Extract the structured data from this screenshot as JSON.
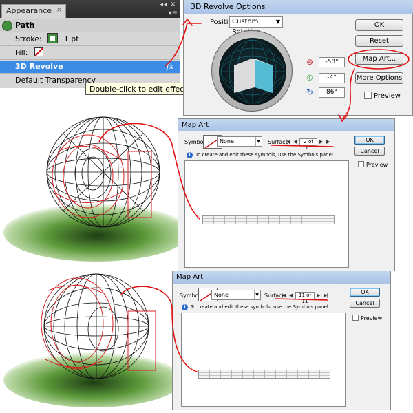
{
  "appearance": {
    "tab_label": "Appearance",
    "tab_close": "×",
    "panel_controls": "◂◂ ✕",
    "menu_glyph": "▾≡",
    "rows": {
      "path": "Path",
      "stroke_label": "Stroke:",
      "stroke_value": "1 pt",
      "fill_label": "Fill:",
      "effect": "3D Revolve",
      "effect_icon": "fx",
      "transparency": "Default Transparency"
    },
    "tooltip": "Double-click to edit effect"
  },
  "revolve_dialog": {
    "title": "3D Revolve Options",
    "position_label": "Position:",
    "position_value": "Custom Rotation",
    "rotation": {
      "x": "-58°",
      "y": "-4°",
      "z": "86°"
    },
    "buttons": {
      "ok": "OK",
      "reset": "Reset",
      "map_art": "Map Art...",
      "more_options": "More Options"
    },
    "preview_label": "Preview"
  },
  "map_art_dialogs": [
    {
      "title": "Map Art",
      "symbol_label": "Symbol:",
      "symbol_value": "None",
      "surface_label": "Surface:",
      "surface_value": "2 of 11",
      "info": "To create and edit these symbols, use the Symbols panel.",
      "ok": "OK",
      "cancel": "Cancel",
      "preview": "Preview"
    },
    {
      "title": "Map Art",
      "symbol_label": "Symbol:",
      "symbol_value": "None",
      "surface_label": "Surface:",
      "surface_value": "11 of 11",
      "info": "To create and edit these symbols, use the Symbols panel.",
      "ok": "OK",
      "cancel": "Cancel",
      "preview": "Preview"
    }
  ],
  "nav_glyphs": {
    "first": "|◀",
    "prev": "◀",
    "next": "▶",
    "last": "▶|"
  },
  "colors": {
    "annotation_red": "#e01010",
    "selection_blue": "#3c8ce6",
    "dialog_bg": "#f0f0f0",
    "wireframe": "#111111",
    "surface_highlight": "#d62222",
    "grass_green": "#5d9a3a"
  }
}
